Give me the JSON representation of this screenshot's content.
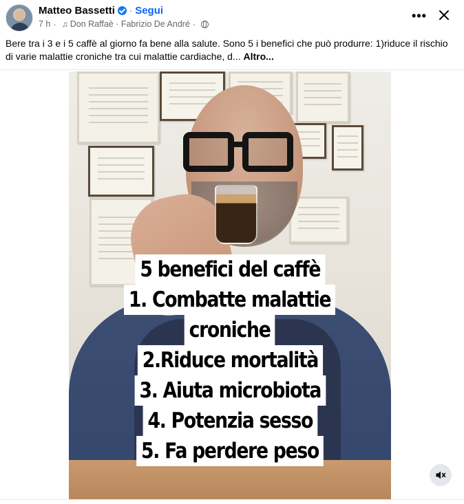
{
  "post": {
    "author": "Matteo Bassetti",
    "follow_label": "Segui",
    "separator": "·",
    "time": "7 h",
    "audio_track": "Don Raffaè · Fabrizio De André",
    "caption": "Bere tra i 3 e i 5 caffè al giorno fa bene alla salute. Sono 5 i benefici che può produrre: 1)riduce il rischio di varie malattie croniche tra cui malattie cardiache, d...",
    "see_more_label": "Altro...",
    "icons": {
      "verified": "verified-badge-icon",
      "music": "music-note-icon",
      "audience": "globe-icon",
      "more": "more-options-icon",
      "close": "close-icon",
      "mute": "muted-speaker-icon"
    }
  },
  "media": {
    "overlay_lines": [
      "5 benefici del caffè",
      "1. Combatte malattie",
      "croniche",
      "2.Riduce mortalità",
      "3. Aiuta microbiota",
      "4. Potenzia sesso",
      "5. Fa perdere peso"
    ]
  },
  "colors": {
    "link_blue": "#0866ff",
    "verified_blue": "#1877f2",
    "secondary_text": "#65676b",
    "overlay_bg": "#ffffff"
  }
}
